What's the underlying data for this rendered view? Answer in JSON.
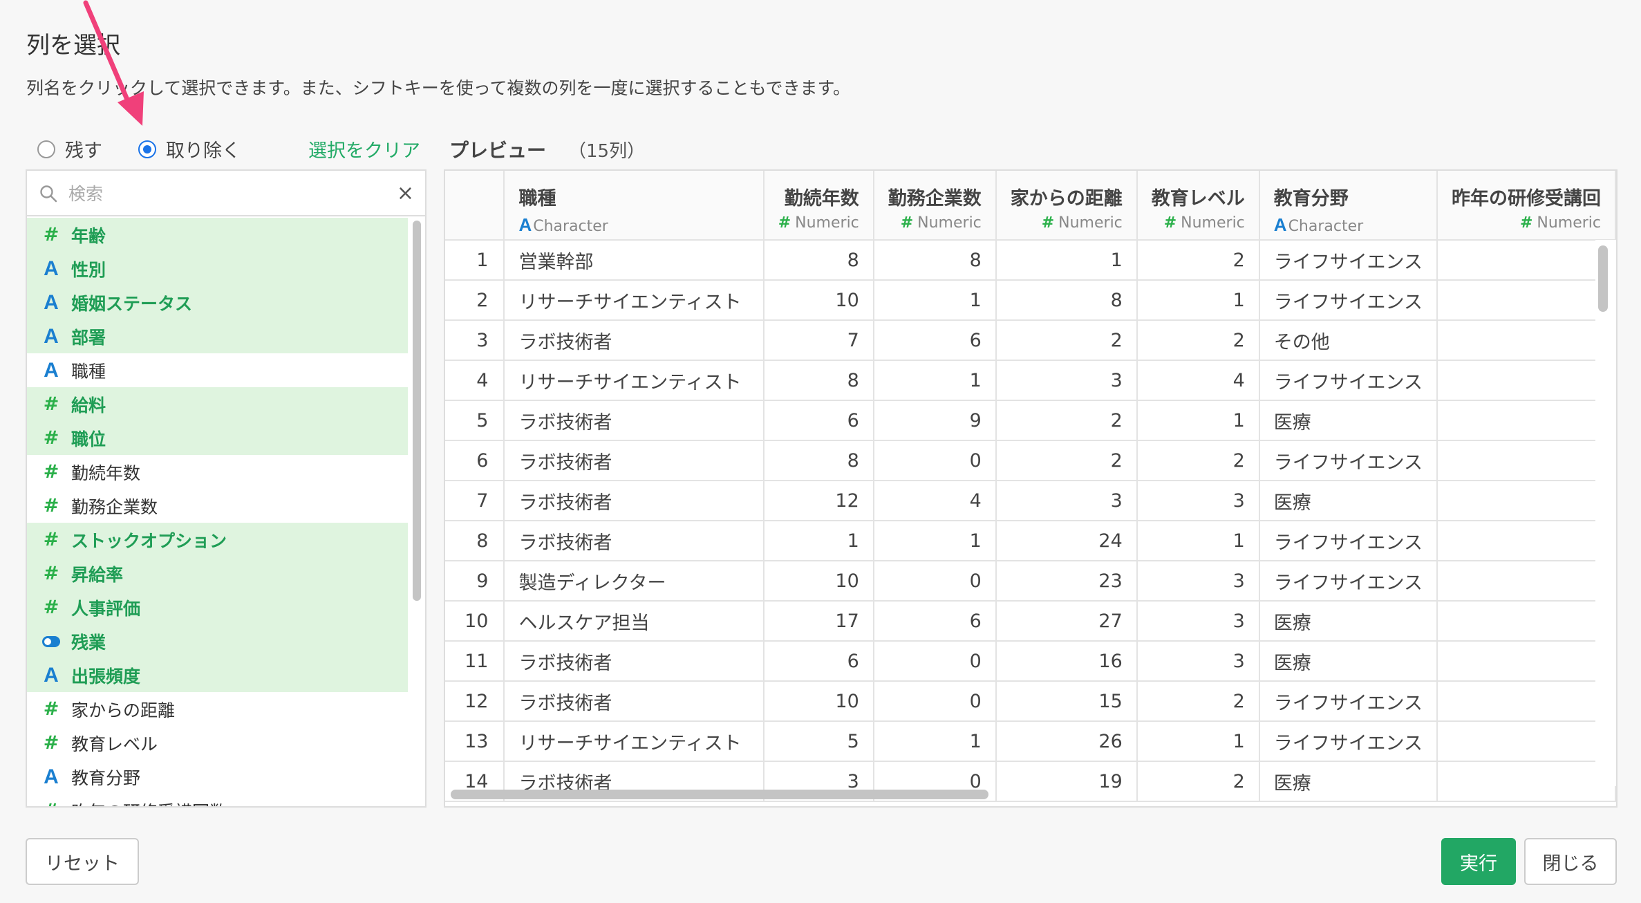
{
  "dialog": {
    "title": "列を選択",
    "description": "列名をクリックして選択できます。また、シフトキーを使って複数の列を一度に選択することもできます。"
  },
  "mode": {
    "keep_label": "残す",
    "remove_label": "取り除く",
    "selected": "remove",
    "clear_label": "選択をクリア"
  },
  "preview": {
    "title": "プレビュー",
    "count": "（15列）"
  },
  "search": {
    "placeholder": "検索",
    "value": ""
  },
  "columns": [
    {
      "name": "年齢",
      "type": "numeric",
      "selected": true
    },
    {
      "name": "性別",
      "type": "character",
      "selected": true
    },
    {
      "name": "婚姻ステータス",
      "type": "character",
      "selected": true
    },
    {
      "name": "部署",
      "type": "character",
      "selected": true
    },
    {
      "name": "職種",
      "type": "character",
      "selected": false
    },
    {
      "name": "給料",
      "type": "numeric",
      "selected": true
    },
    {
      "name": "職位",
      "type": "numeric",
      "selected": true
    },
    {
      "name": "勤続年数",
      "type": "numeric",
      "selected": false
    },
    {
      "name": "勤務企業数",
      "type": "numeric",
      "selected": false
    },
    {
      "name": "ストックオプション",
      "type": "numeric",
      "selected": true
    },
    {
      "name": "昇給率",
      "type": "numeric",
      "selected": true
    },
    {
      "name": "人事評価",
      "type": "numeric",
      "selected": true
    },
    {
      "name": "残業",
      "type": "logical",
      "selected": true
    },
    {
      "name": "出張頻度",
      "type": "character",
      "selected": true
    },
    {
      "name": "家からの距離",
      "type": "numeric",
      "selected": false
    },
    {
      "name": "教育レベル",
      "type": "numeric",
      "selected": false
    },
    {
      "name": "教育分野",
      "type": "character",
      "selected": false
    },
    {
      "name": "昨年の研修受講回数",
      "type": "numeric",
      "selected": false
    }
  ],
  "table": {
    "headers": [
      {
        "name": "職種",
        "type": "Character",
        "align": "left"
      },
      {
        "name": "勤続年数",
        "type": "Numeric",
        "align": "right"
      },
      {
        "name": "勤務企業数",
        "type": "Numeric",
        "align": "right"
      },
      {
        "name": "家からの距離",
        "type": "Numeric",
        "align": "right"
      },
      {
        "name": "教育レベル",
        "type": "Numeric",
        "align": "right"
      },
      {
        "name": "教育分野",
        "type": "Character",
        "align": "left"
      },
      {
        "name": "昨年の研修受講回",
        "type": "Numeric",
        "align": "right"
      }
    ],
    "rows": [
      [
        "1",
        "営業幹部",
        "8",
        "8",
        "1",
        "2",
        "ライフサイエンス",
        ""
      ],
      [
        "2",
        "リサーチサイエンティスト",
        "10",
        "1",
        "8",
        "1",
        "ライフサイエンス",
        ""
      ],
      [
        "3",
        "ラボ技術者",
        "7",
        "6",
        "2",
        "2",
        "その他",
        ""
      ],
      [
        "4",
        "リサーチサイエンティスト",
        "8",
        "1",
        "3",
        "4",
        "ライフサイエンス",
        ""
      ],
      [
        "5",
        "ラボ技術者",
        "6",
        "9",
        "2",
        "1",
        "医療",
        ""
      ],
      [
        "6",
        "ラボ技術者",
        "8",
        "0",
        "2",
        "2",
        "ライフサイエンス",
        ""
      ],
      [
        "7",
        "ラボ技術者",
        "12",
        "4",
        "3",
        "3",
        "医療",
        ""
      ],
      [
        "8",
        "ラボ技術者",
        "1",
        "1",
        "24",
        "1",
        "ライフサイエンス",
        ""
      ],
      [
        "9",
        "製造ディレクター",
        "10",
        "0",
        "23",
        "3",
        "ライフサイエンス",
        ""
      ],
      [
        "10",
        "ヘルスケア担当",
        "17",
        "6",
        "27",
        "3",
        "医療",
        ""
      ],
      [
        "11",
        "ラボ技術者",
        "6",
        "0",
        "16",
        "3",
        "医療",
        ""
      ],
      [
        "12",
        "ラボ技術者",
        "10",
        "0",
        "15",
        "2",
        "ライフサイエンス",
        ""
      ],
      [
        "13",
        "リサーチサイエンティスト",
        "5",
        "1",
        "26",
        "1",
        "ライフサイエンス",
        ""
      ],
      [
        "14",
        "ラボ技術者",
        "3",
        "0",
        "19",
        "2",
        "医療",
        ""
      ]
    ]
  },
  "buttons": {
    "reset": "リセット",
    "run": "実行",
    "close": "閉じる"
  },
  "colors": {
    "accent_green": "#22a764",
    "selected_bg": "#dff4df",
    "numeric_icon": "#2bb04a",
    "character_icon": "#1a7fd0",
    "radio_blue": "#1a73e8",
    "annotation_arrow": "#f0407a"
  },
  "icons": {
    "numeric": "#",
    "character": "A",
    "logical": "toggle-icon",
    "search": "search-icon",
    "clear": "×"
  }
}
